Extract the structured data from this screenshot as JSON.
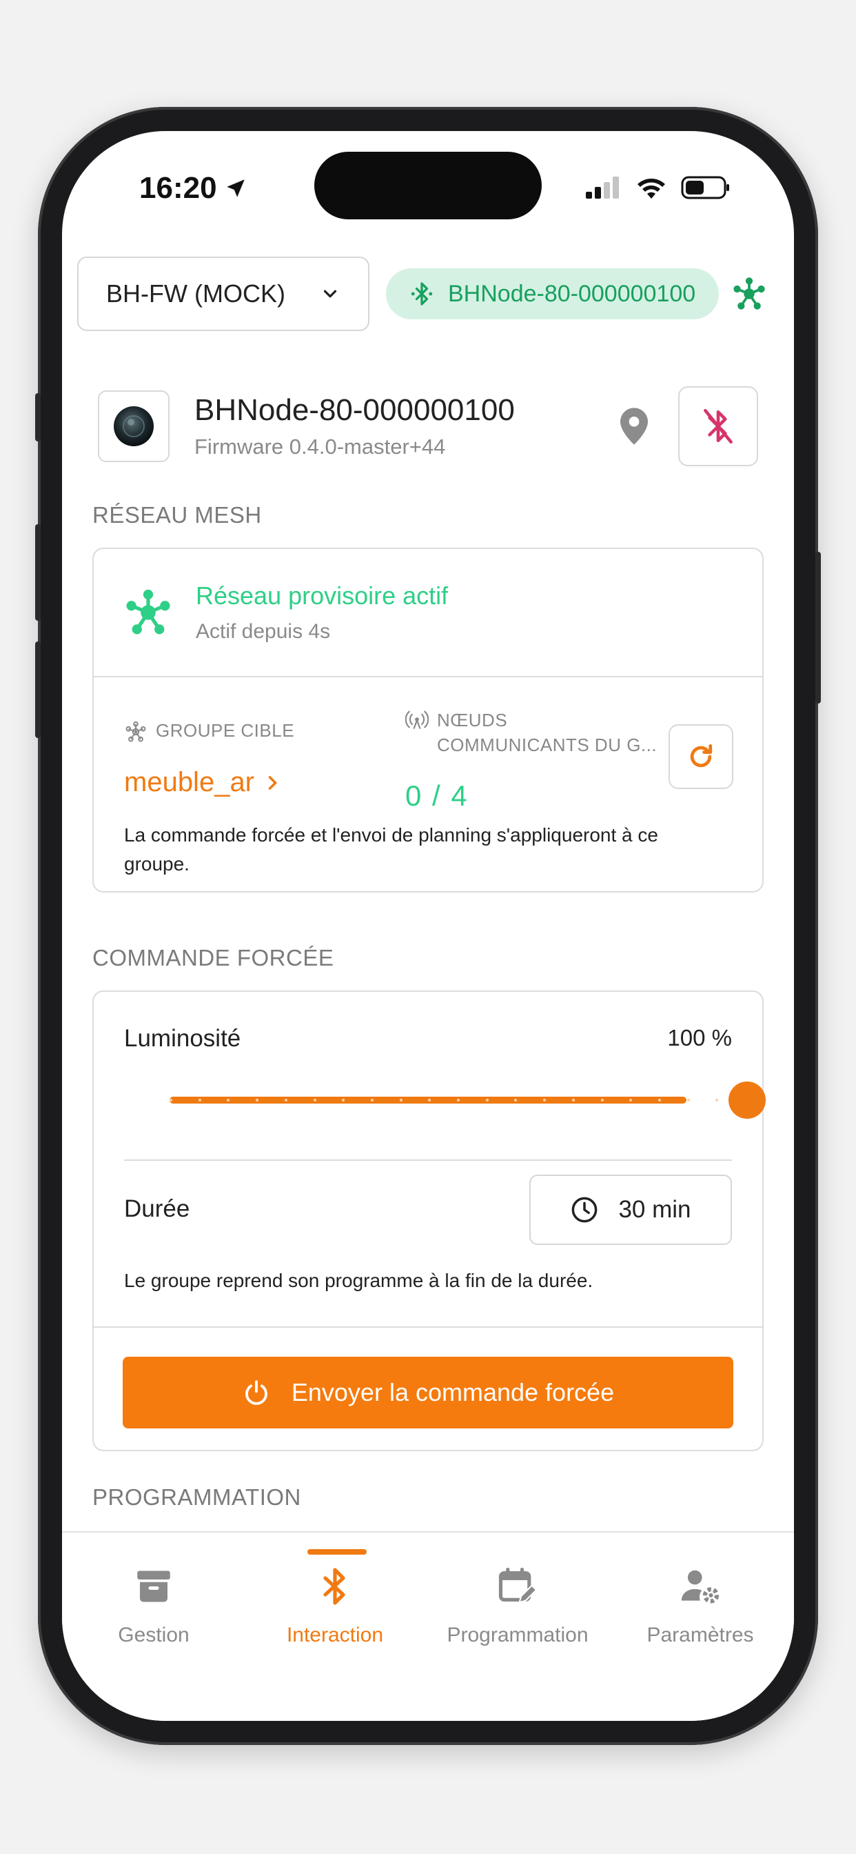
{
  "status_bar": {
    "time": "16:20"
  },
  "header": {
    "network_select": "BH-FW (MOCK)",
    "connection_pill": "BHNode-80-000000100"
  },
  "device": {
    "name": "BHNode-80-000000100",
    "firmware": "Firmware 0.4.0-master+44"
  },
  "mesh": {
    "section_title": "RÉSEAU MESH",
    "status_title": "Réseau provisoire actif",
    "status_sub": "Actif depuis 4s",
    "target_group_label": "GROUPE CIBLE",
    "target_group": "meuble_ar",
    "nodes_label_line1": "NŒUDS",
    "nodes_label_line2": "COMMUNICANTS DU G...",
    "nodes_count": "0 / 4",
    "note": "La commande forcée et l'envoi de planning s'appliqueront à ce groupe."
  },
  "forced": {
    "section_title": "COMMANDE FORCÉE",
    "brightness_label": "Luminosité",
    "brightness_value": "100 %",
    "brightness_level": 1.0,
    "duration_label": "Durée",
    "duration_value": "30 min",
    "duration_note": "Le groupe reprend son programme à la fin de la durée.",
    "send_label": "Envoyer la commande forcée"
  },
  "programmation": {
    "section_title": "PROGRAMMATION"
  },
  "tabs": [
    {
      "label": "Gestion",
      "icon": "archive-box-icon",
      "active": false
    },
    {
      "label": "Interaction",
      "icon": "bluetooth-icon",
      "active": true
    },
    {
      "label": "Programmation",
      "icon": "calendar-edit-icon",
      "active": false
    },
    {
      "label": "Paramètres",
      "icon": "user-settings-icon",
      "active": false
    }
  ],
  "colors": {
    "accent": "#F07A12",
    "mesh_green": "#2ECF86",
    "ble_green": "#18A05E",
    "bt_off_red": "#D6336C"
  }
}
